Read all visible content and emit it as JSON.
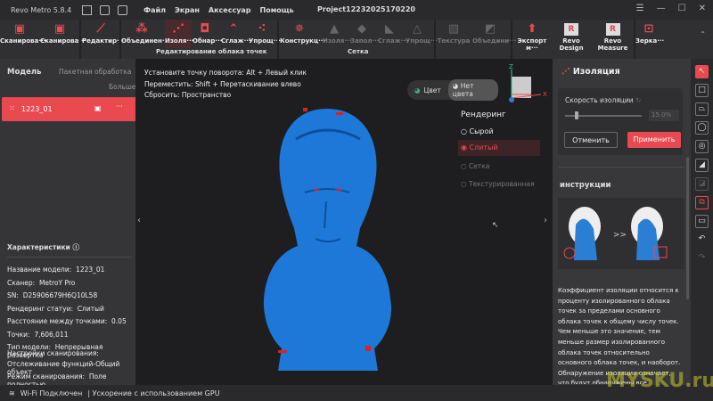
{
  "app": {
    "title": "Revo Metro 5.8.4",
    "project": "Project12232025170220",
    "menu": [
      "Файл",
      "Экран",
      "Аксессуар",
      "Помощь"
    ]
  },
  "ribbon": {
    "tools": [
      "Сканирова···",
      "Сканирова···",
      "Редактир···",
      "Объединен···",
      "Изоля···",
      "Обнар···",
      "Сглаж···",
      "Упрощ···",
      "Конструкц···",
      "Изоля···",
      "Запол···",
      "Сглаж···",
      "Упрощ···",
      "Текстура",
      "Объедини···",
      "Экспорт м···",
      "Revo Design",
      "Revo Measure",
      "Зерка···"
    ],
    "groups": {
      "cloud": "Редактирование облака точек",
      "mesh": "Сетка"
    }
  },
  "left": {
    "title": "Модель",
    "batch": "Пакетная обработка",
    "more": "Больше",
    "model_name": "1223_01",
    "characteristics": "Характеристики",
    "props": [
      [
        "Название модели:",
        "1223_01"
      ],
      [
        "Сканер:",
        "MetroY Pro"
      ],
      [
        "SN:",
        "D25906679H6Q10L58"
      ],
      [
        "Рендеринг статуи:",
        "Слитый"
      ],
      [
        "Расстояние между точками:",
        "0.05"
      ],
      [
        "Точки:",
        "7,606,011"
      ],
      [
        "Тип модели:",
        "Непрерывная развертка"
      ]
    ],
    "scan_settings_label": "Настройки сканирования:",
    "scan_settings_value": "Отслеживание функций-Общий объект",
    "scan_mode": [
      "Режим сканирования:",
      "Поле полностью"
    ]
  },
  "viewport": {
    "hints": [
      "Установите точку поворота: Alt + Левый клик",
      "Переместить: Shift + Перетаскивание влево",
      "Сбросить: Пространство"
    ],
    "color_toggle": [
      "Цвет",
      "Нет цвета"
    ],
    "rendering_title": "Рендеринг",
    "rendering_options": [
      "Сырой",
      "Слитый",
      "Сетка",
      "Текстурированная"
    ],
    "selected": "Слитый",
    "axes": [
      "Z",
      "X"
    ]
  },
  "right": {
    "title": "Изоляция",
    "speed_label": "Скорость изоляции",
    "speed_value": "15.0%",
    "speed_fraction": 0.15,
    "cancel": "Отменить",
    "apply": "Применить",
    "instructions_title": "инструкции",
    "instructions": "Коэффициент изоляции относится к проценту изолированного облака точек за пределами основного облака точек к общему числу точек. Чем меньше это значение, тем меньше размер изолированного облака точек относительно основного облака точек, и наоборот. Обнаружение изоляции означает, что будут обнаружены все изолированные облака точек с размером меньше заданного значения. Увеличение"
  },
  "status": {
    "wifi": "Wi-Fi Подключен",
    "gpu": "| Ускорение с использованием GPU"
  },
  "watermark": "MYSKU.ru",
  "colors": {
    "accent": "#e84a4f",
    "model": "#1e78d8"
  }
}
